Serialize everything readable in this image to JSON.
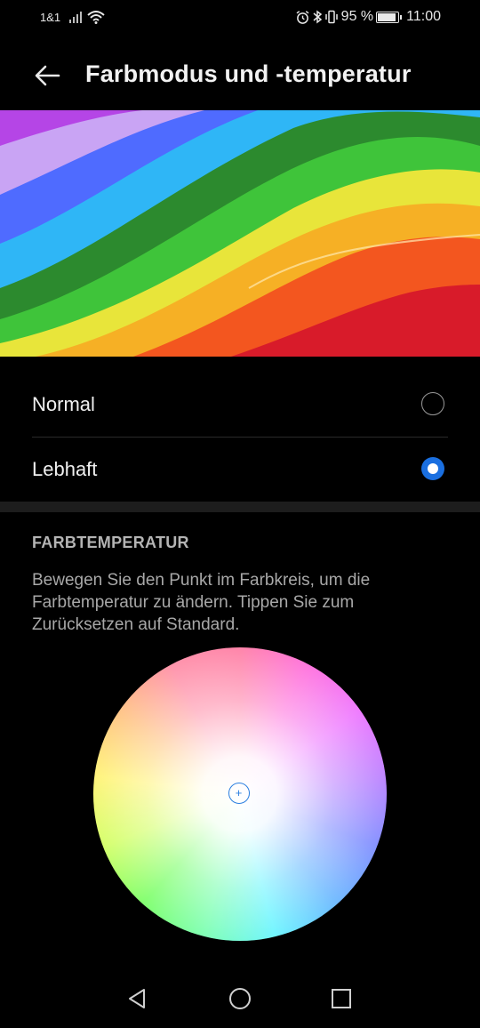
{
  "status_bar": {
    "carrier": "1&1",
    "battery_percent": "95 %",
    "time": "11:00",
    "icons": [
      "signal-icon",
      "wifi-icon",
      "alarm-icon",
      "bluetooth-icon",
      "vibrate-icon",
      "battery-icon"
    ]
  },
  "header": {
    "title": "Farbmodus und -temperatur",
    "back_icon": "back-arrow-icon"
  },
  "color_modes": {
    "options": [
      {
        "label": "Normal",
        "selected": false
      },
      {
        "label": "Lebhaft",
        "selected": true
      }
    ],
    "accent_color": "#1a6fe0"
  },
  "temperature": {
    "section_title": "FARBTEMPERATUR",
    "description": "Bewegen Sie den Punkt im Farbkreis, um die Farbtemperatur zu ändern. Tippen Sie zum Zurücksetzen auf Standard.",
    "picker_icon": "crosshair-plus-icon"
  },
  "nav_bar": {
    "icons": [
      "back-triangle-icon",
      "home-circle-icon",
      "recents-square-icon"
    ]
  }
}
